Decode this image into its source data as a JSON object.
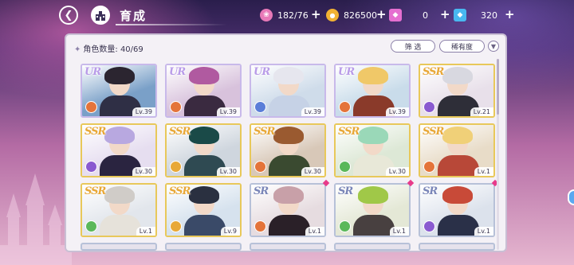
{
  "header": {
    "title": "育成",
    "back_icon": "back-arrow-icon",
    "home_icon": "castle-home-icon"
  },
  "resources": [
    {
      "name": "candy",
      "icon": "candy-icon",
      "value": "182/76",
      "color": "#e879b8"
    },
    {
      "name": "coin",
      "icon": "coin-icon",
      "value": "826500",
      "color": "#f2b233"
    },
    {
      "name": "gem-pink",
      "icon": "pink-gem-icon",
      "value": "0",
      "color": "#e56fd0"
    },
    {
      "name": "gem-blue",
      "icon": "blue-gem-icon",
      "value": "320",
      "color": "#49b8f0"
    }
  ],
  "panel": {
    "count_label": "角色数量: 40/69",
    "filter_label": "筛 选",
    "sort_label": "稀有度",
    "dropdown_icon": "chevron-down-icon"
  },
  "cards": [
    {
      "rarity": "UR",
      "level": "Lv.39",
      "element": "#e4743a",
      "hair": "#2b2530",
      "body": "#2f2f45",
      "bg": "#7aa0c8",
      "new": false
    },
    {
      "rarity": "UR",
      "level": "Lv.39",
      "element": "#e4743a",
      "hair": "#b05aa0",
      "body": "#3a2a40",
      "bg": "#d8c2dc",
      "new": false
    },
    {
      "rarity": "UR",
      "level": "Lv.39",
      "element": "#5a7ed8",
      "hair": "#e6e6ee",
      "body": "#c6d2e6",
      "bg": "#cfdcea",
      "new": false
    },
    {
      "rarity": "UR",
      "level": "Lv.39",
      "element": "#e4743a",
      "hair": "#f0c868",
      "body": "#8a3a2a",
      "bg": "#c9dcea",
      "new": false
    },
    {
      "rarity": "SSR",
      "level": "Lv.21",
      "element": "#8a5ad0",
      "hair": "#d8d8e0",
      "body": "#2e2e38",
      "bg": "#e8e0ea",
      "new": false
    },
    {
      "rarity": "SSR",
      "level": "Lv.30",
      "element": "#8a5ad0",
      "hair": "#b8a8e0",
      "body": "#2a2440",
      "bg": "#e6def0",
      "new": false
    },
    {
      "rarity": "SSR",
      "level": "Lv.30",
      "element": "#e8a838",
      "hair": "#1a4a48",
      "body": "#2f4a52",
      "bg": "#cfd6de",
      "new": false
    },
    {
      "rarity": "SSR",
      "level": "Lv.30",
      "element": "#e4743a",
      "hair": "#9a5a30",
      "body": "#3a4a30",
      "bg": "#d8c8b8",
      "new": false
    },
    {
      "rarity": "SSR",
      "level": "Lv.30",
      "element": "#5ab85a",
      "hair": "#9ad8b8",
      "body": "#e8e8d8",
      "bg": "#dde8d6",
      "new": false
    },
    {
      "rarity": "SSR",
      "level": "Lv.1",
      "element": "#e4743a",
      "hair": "#f0d078",
      "body": "#b84838",
      "bg": "#e8dcc8",
      "new": false
    },
    {
      "rarity": "SSR",
      "level": "Lv.1",
      "element": "#5ab85a",
      "hair": "#d0ccc8",
      "body": "#e6e2da",
      "bg": "#e2e6ec",
      "new": false
    },
    {
      "rarity": "SSR",
      "level": "Lv.9",
      "element": "#e8a838",
      "hair": "#2a3040",
      "body": "#3a4a68",
      "bg": "#d6e2ee",
      "new": false
    },
    {
      "rarity": "SR",
      "level": "Lv.1",
      "element": "#e4743a",
      "hair": "#c8a0a8",
      "body": "#2a2028",
      "bg": "#e6dce0",
      "new": true
    },
    {
      "rarity": "SR",
      "level": "Lv.1",
      "element": "#5ab85a",
      "hair": "#a0c848",
      "body": "#484040",
      "bg": "#e4e8d6",
      "new": true
    },
    {
      "rarity": "SR",
      "level": "Lv.1",
      "element": "#8a5ad0",
      "hair": "#c84a38",
      "body": "#2a3048",
      "bg": "#dce2ec",
      "new": true
    }
  ]
}
